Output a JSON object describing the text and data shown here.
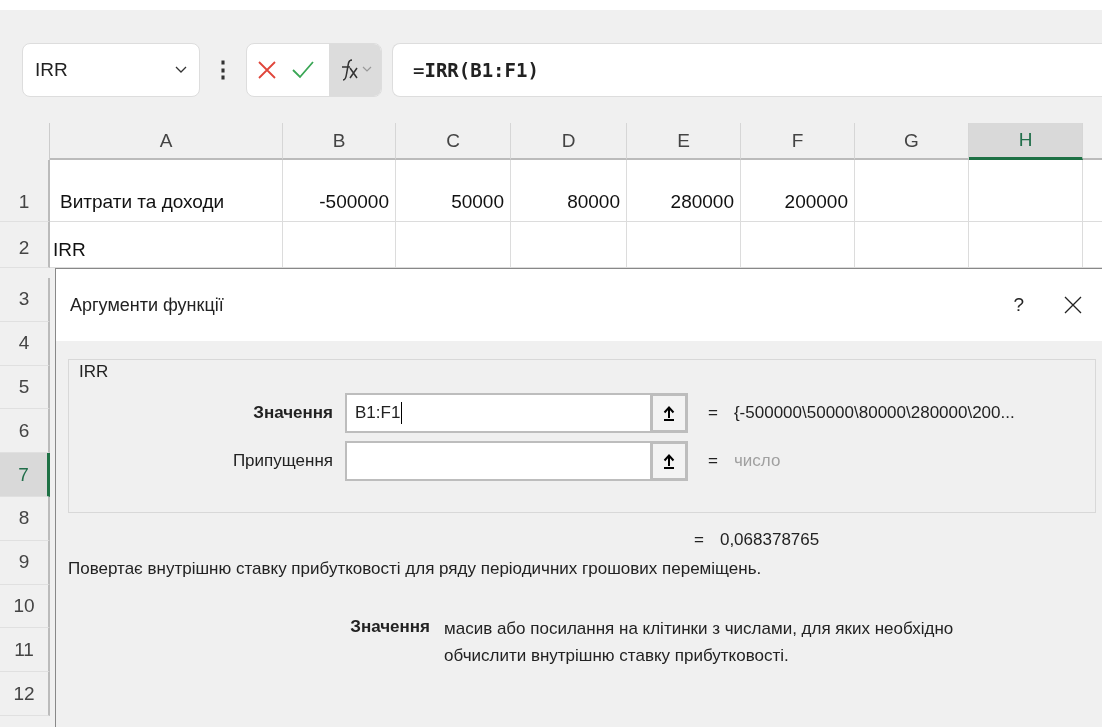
{
  "name_box": {
    "value": "IRR"
  },
  "formula_bar": {
    "more": "⋮",
    "value": "=**IRR(B1:F1)**"
  },
  "columns": [
    {
      "label": "A",
      "selected": false
    },
    {
      "label": "B",
      "selected": false
    },
    {
      "label": "C",
      "selected": false
    },
    {
      "label": "D",
      "selected": false
    },
    {
      "label": "E",
      "selected": false
    },
    {
      "label": "F",
      "selected": false
    },
    {
      "label": "G",
      "selected": false
    },
    {
      "label": "H",
      "selected": true
    }
  ],
  "rows": [
    {
      "number": "1",
      "selected": false,
      "cells": [
        {
          "text": "Витрати та доходи",
          "kind": "text"
        },
        {
          "text": "-500000",
          "kind": "number"
        },
        {
          "text": "50000",
          "kind": "number"
        },
        {
          "text": "80000",
          "kind": "number"
        },
        {
          "text": "280000",
          "kind": "number"
        },
        {
          "text": "200000",
          "kind": "number"
        }
      ]
    },
    {
      "number": "2",
      "selected": false,
      "cells": [
        {
          "text": "IRR",
          "kind": "text"
        }
      ]
    }
  ],
  "hidden_row_headers": [
    {
      "number": "3",
      "selected": false
    },
    {
      "number": "4",
      "selected": false
    },
    {
      "number": "5",
      "selected": false
    },
    {
      "number": "6",
      "selected": false
    },
    {
      "number": "7",
      "selected": true
    },
    {
      "number": "8",
      "selected": false
    },
    {
      "number": "9",
      "selected": false
    },
    {
      "number": "10",
      "selected": false
    },
    {
      "number": "11",
      "selected": false
    },
    {
      "number": "12",
      "selected": false
    }
  ],
  "dialog": {
    "title": "Аргументи функції",
    "help": "?",
    "group_label": "IRR",
    "arguments": [
      {
        "label": "Значення",
        "active": true,
        "value": "B1:F1",
        "sign": "=",
        "result": "{-500000\\50000\\80000\\280000\\200...",
        "muted": false
      },
      {
        "label": "Припущення",
        "active": false,
        "sign": "=",
        "result": "число",
        "muted": true
      }
    ],
    "formula_result": {
      "sign": "=",
      "value": "0,068378765"
    },
    "description": "Повертає внутрішню ставку прибутковості для ряду періодичних грошових переміщень.",
    "argument_help": {
      "label": "Значення",
      "text": "масив або посилання на клітинки з числами, для яких необхідно обчислити внутрішню ставку прибутковості."
    }
  }
}
